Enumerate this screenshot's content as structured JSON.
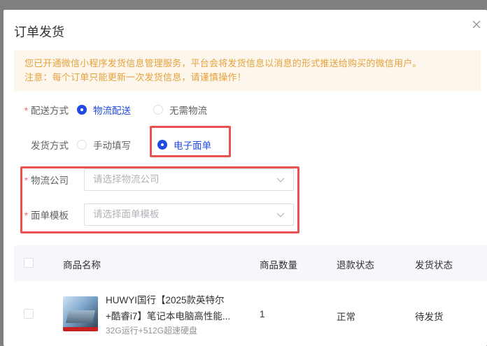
{
  "dialog": {
    "title": "订单发货"
  },
  "notice": {
    "line1": "您已开通微信小程序发货信息管理服务，平台会将发货信息以消息的形式推送给购买的微信用户。",
    "line2": "注意：每个订单只能更新一次发货信息，请谨慎操作！"
  },
  "delivery_method": {
    "required_mark": "*",
    "label": "配送方式",
    "options": [
      "物流配送",
      "无需物流"
    ],
    "selected": "物流配送"
  },
  "shipping_mode": {
    "label": "发货方式",
    "options": [
      "手动填写",
      "电子面单"
    ],
    "selected": "电子面单"
  },
  "logistics_company": {
    "required_mark": "*",
    "label": "物流公司",
    "placeholder": "请选择物流公司"
  },
  "waybill_template": {
    "required_mark": "*",
    "label": "面单模板",
    "placeholder": "请选择面单模板"
  },
  "table": {
    "headers": [
      "商品名称",
      "商品数量",
      "退款状态",
      "发货状态"
    ],
    "rows": [
      {
        "name_line1": "HUWYI国行【2025款英特尔",
        "name_line2": "+酷睿i7】笔记本电脑高性能...",
        "sku": "32G运行+512G超速硬盘",
        "quantity": "1",
        "refund_status": "正常",
        "ship_status": "待发货"
      }
    ]
  },
  "colors": {
    "accent": "#1f4be0",
    "warning_text": "#e6a23c",
    "warning_bg": "#fdf6ec",
    "highlight_border": "#ea5252"
  }
}
